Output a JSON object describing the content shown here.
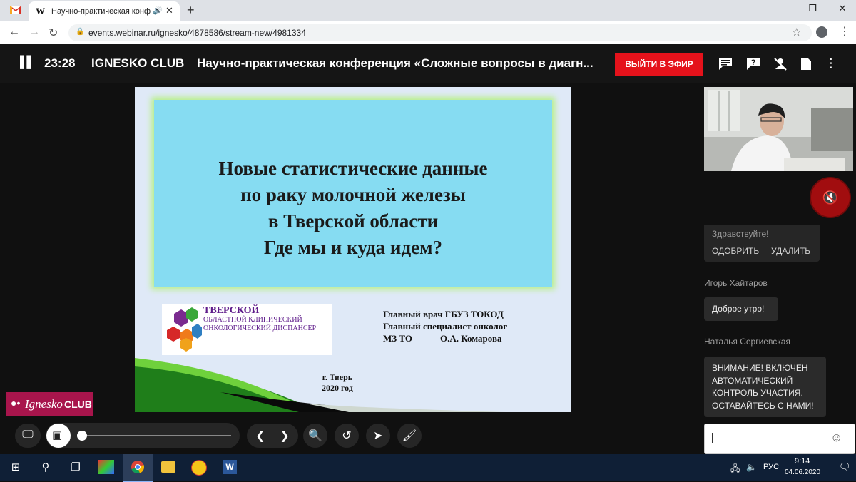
{
  "browser": {
    "tab_title": "Научно-практическая конф",
    "tab_favicon": "W",
    "new_tab": "+",
    "url": "events.webinar.ru/ignesko/4878586/stream-new/4981334",
    "win_minimize": "—",
    "win_restore": "❐",
    "win_close": "✕"
  },
  "webinar": {
    "time": "23:28",
    "club": "IGNESKO CLUB",
    "title": "Научно-практическая конференция «Сложные вопросы в диагн...",
    "on_air_button": "ВЫЙТИ В ЭФИР"
  },
  "slide": {
    "title_lines": [
      "Новые статистические данные",
      "по раку молочной железы",
      "в Тверской области",
      "Где мы и куда идем?"
    ],
    "logo_line1": "ТВЕРСКОЙ",
    "logo_line2": "ОБЛАСТНОЙ КЛИНИЧЕСКИЙ",
    "logo_line3": "ОНКОЛОГИЧЕСКИЙ ДИСПАНСЕР",
    "author_lines": [
      "Главный врач ГБУЗ ТОКОД",
      "Главный специалист онколог",
      "МЗ ТО            О.А. Комарова"
    ],
    "city": "г. Тверь",
    "year": "2020 год"
  },
  "chat": {
    "message1": "Здравствуйте!",
    "approve": "ОДОБРИТЬ",
    "delete": "УДАЛИТЬ",
    "author2": "Игорь Хайтаров",
    "message2": "Доброе утро!",
    "author3": "Наталья Сергиевская",
    "message3_lines": [
      "ВНИМАНИЕ! ВКЛЮЧЕН",
      "АВТОМАТИЧЕСКИЙ",
      "КОНТРОЛЬ УЧАСТИЯ.",
      "ОСТАВАЙТЕСЬ С НАМИ!"
    ]
  },
  "watermark": {
    "brand_italic": "Ignesko",
    "brand_bold": "CLUB"
  },
  "taskbar": {
    "language": "РУС",
    "clock_time": "9:14",
    "clock_date": "04.06.2020"
  },
  "colors": {
    "on_air": "#e5121b",
    "mute": "#a10d0f",
    "taskbar": "#0f1f36"
  }
}
